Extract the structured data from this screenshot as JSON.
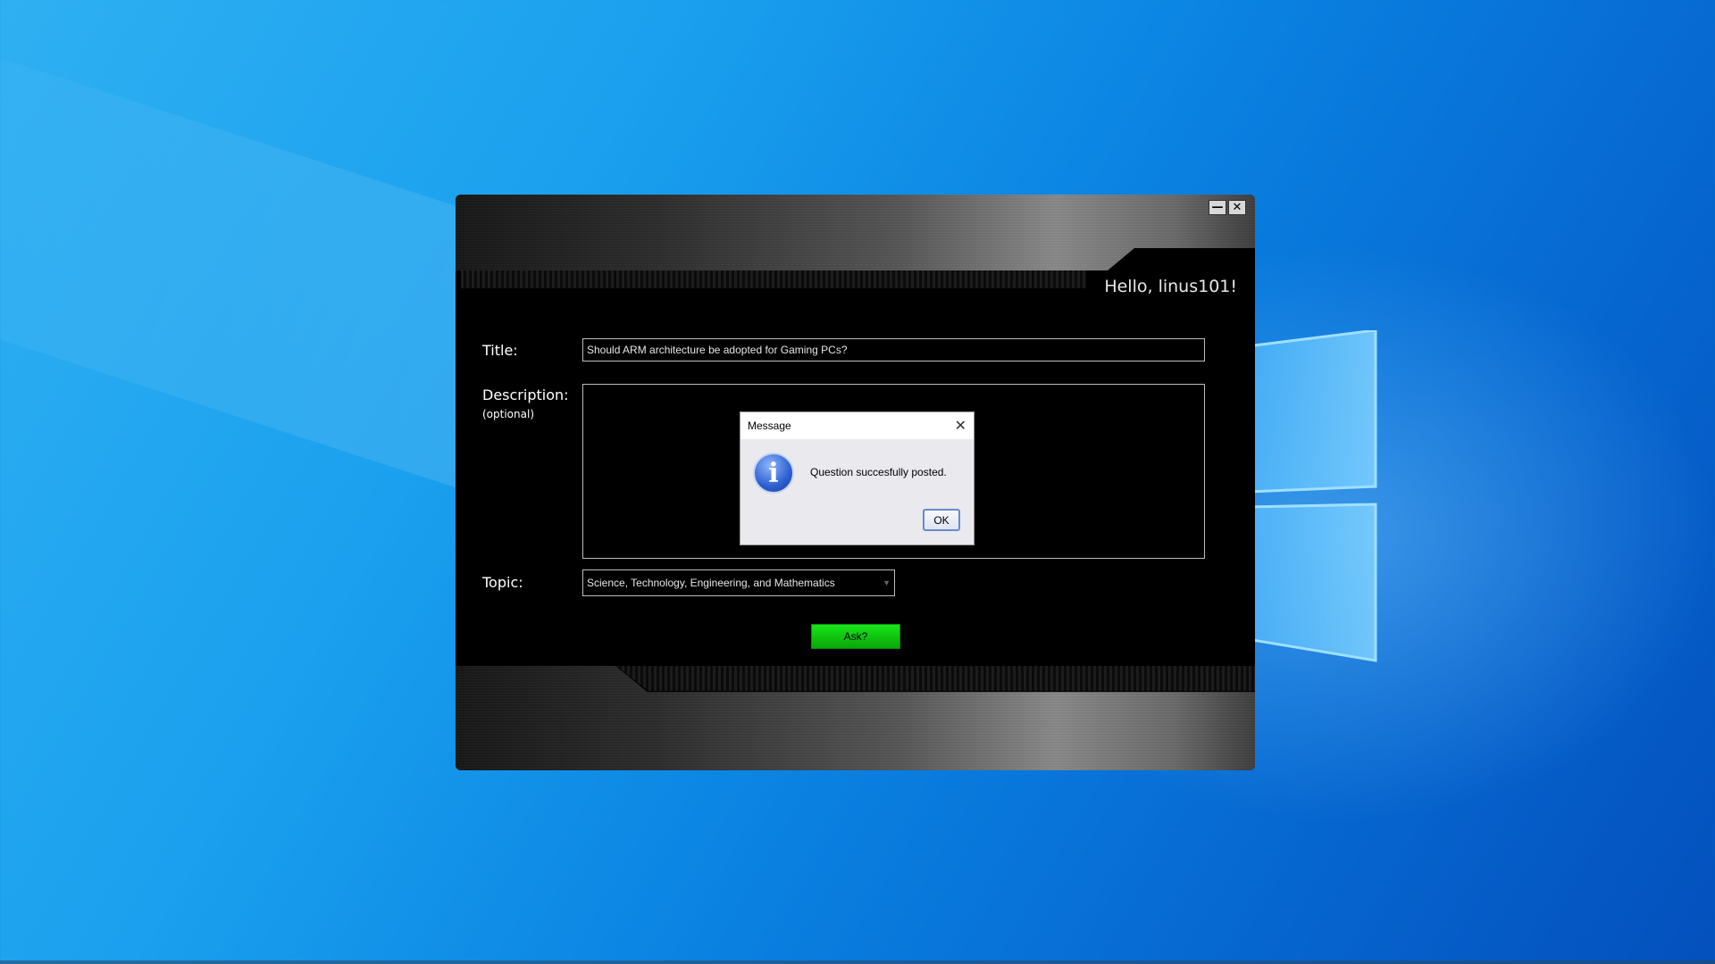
{
  "window": {
    "greeting": "Hello, linus101!",
    "minimize_glyph": "—",
    "close_glyph": "✕"
  },
  "form": {
    "title_label": "Title:",
    "title_value": "Should ARM architecture be adopted for Gaming PCs?",
    "description_label": "Description:",
    "description_sublabel": "(optional)",
    "description_value": "",
    "topic_label": "Topic:",
    "topic_value": "Science, Technology, Engineering, and Mathematics",
    "topic_arrow": "▼",
    "ask_label": "Ask?"
  },
  "dialog": {
    "title": "Message",
    "close_glyph": "✕",
    "icon": "info-icon",
    "icon_glyph": "i",
    "message": "Question succesfully posted.",
    "ok_label": "OK"
  },
  "colors": {
    "desktop": "#1a9bee",
    "app_bg": "#000000",
    "ask_button": "#12c912",
    "dialog_bg": "#e9e9ee"
  }
}
